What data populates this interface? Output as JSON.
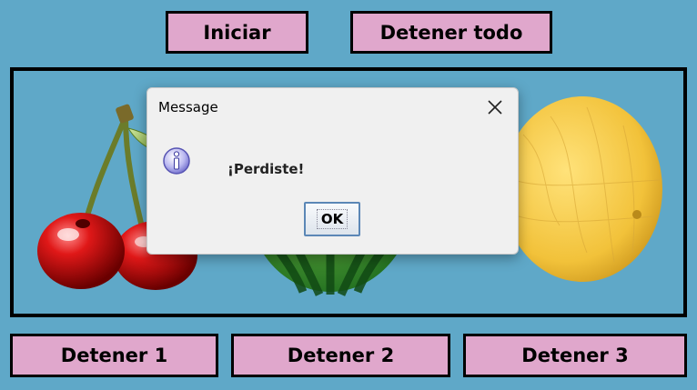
{
  "top_buttons": {
    "start": "Iniciar",
    "stop_all": "Detener todo"
  },
  "bottom_buttons": {
    "stop1": "Detener 1",
    "stop2": "Detener 2",
    "stop3": "Detener 3"
  },
  "reels": [
    {
      "fruit": "cherry-icon"
    },
    {
      "fruit": "watermelon-icon"
    },
    {
      "fruit": "melon-icon"
    }
  ],
  "dialog": {
    "title": "Message",
    "message": "¡Perdiste!",
    "ok_label": "OK",
    "icon": "info-icon",
    "close_icon": "close-icon"
  },
  "colors": {
    "background": "#5fa8c8",
    "button_fill": "#e0a7cc",
    "border": "#000000"
  }
}
